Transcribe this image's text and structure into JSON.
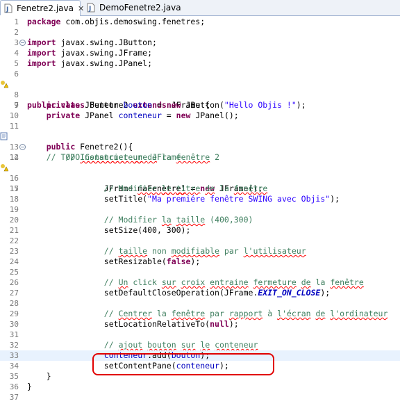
{
  "tabs": [
    {
      "label": "Fenetre2.java",
      "icon": "java-file-icon",
      "active": true,
      "close": "✕"
    },
    {
      "label": "DemoFenetre2.java",
      "icon": "java-file-icon",
      "active": false
    }
  ],
  "line_numbers": [
    "1",
    "2",
    "3",
    "4",
    "5",
    "6",
    "7",
    "8",
    "9",
    "10",
    "11",
    "12",
    "13",
    "14",
    "15",
    "16",
    "17",
    "18",
    "19",
    "20",
    "21",
    "22",
    "23",
    "24",
    "25",
    "26",
    "27",
    "28",
    "29",
    "30",
    "31",
    "32",
    "33",
    "34",
    "35",
    "36",
    "37"
  ],
  "fold_glyph": "−",
  "code": {
    "l1": {
      "kw": "package",
      "rest": " com.objis.demoswing.fenetres;"
    },
    "l3": {
      "kw": "import",
      "rest": " javax.swing.JButton;"
    },
    "l4": {
      "kw": "import",
      "rest": " javax.swing.JFrame;"
    },
    "l5": {
      "kw": "import",
      "rest": " javax.swing.JPanel;"
    },
    "l7": {
      "kw1": "public",
      "kw2": "class",
      "name": "Fenetre2",
      "kw3": "extends",
      "rest": " JFrame {"
    },
    "l9": {
      "kw1": "private",
      "t1": " JButton ",
      "field": "bouton",
      "t2": " = ",
      "kw2": "new",
      "t3": " JButton(",
      "str": "\"Hello Objis !\"",
      "t4": ");"
    },
    "l10": {
      "kw1": "private",
      "t1": " JPanel ",
      "field": "conteneur",
      "t2": " = ",
      "kw2": "new",
      "t3": " JPanel();"
    },
    "l12": {
      "c1": "// TODO ",
      "c2": "Constructeur",
      "c3": " ",
      "c4": "de",
      "c5": " la ",
      "c6": "fenêtre",
      "c7": " 2"
    },
    "l13": {
      "kw": "public",
      "rest": " Fenetre2(){"
    },
    "l14": {
      "c1": "// ",
      "c2": "Instancier",
      "c3": " ",
      "c4": "une",
      "c5": " JFrame"
    },
    "l15": {
      "t1": "JFrame ",
      "var": "maFenetre1",
      "t2": " = ",
      "kw": "new",
      "t3": " JFrame();"
    },
    "l17": {
      "c1": "// Modifier ",
      "c2": "le",
      "c3": " ",
      "c4": "titre",
      "c5": " ",
      "c6": "de",
      "c7": " la ",
      "c8": "fenêtre"
    },
    "l18": {
      "t1": "setTitle(",
      "str": "\"Ma premiére fenêtre SWING avec Objis\"",
      "t2": ");"
    },
    "l20": {
      "c1": "// Modifier ",
      "c2": "la",
      "c3": " ",
      "c4": "taille",
      "c5": " (400,300)"
    },
    "l21": {
      "t1": "setSize(400, 300);"
    },
    "l23": {
      "c1": "// ",
      "c2": "taille",
      "c3": " non ",
      "c4": "modifiable",
      "c5": " par ",
      "c6": "l'utilisateur"
    },
    "l24": {
      "t1": "setResizable(",
      "kw": "false",
      "t2": ");"
    },
    "l26": {
      "c1": "// ",
      "c2": "Un",
      "c3": " click ",
      "c4": "sur",
      "c5": " ",
      "c6": "croix",
      "c7": " ",
      "c8": "entraine",
      "c9": " ",
      "c10": "fermeture",
      "c11": " ",
      "c12": "de",
      "c13": " la ",
      "c14": "fenêtre"
    },
    "l27": {
      "t1": "setDefaultCloseOperation(JFrame.",
      "sf": "EXIT_ON_CLOSE",
      "t2": ");"
    },
    "l29": {
      "c1": "// ",
      "c2": "Centrer",
      "c3": " la ",
      "c4": "fenêtre",
      "c5": " par ",
      "c6": "rapport",
      "c7": " à ",
      "c8": "l'écran",
      "c9": " ",
      "c10": "de",
      "c11": " ",
      "c12": "l'ordinateur"
    },
    "l30": {
      "t1": "setLocationRelativeTo(",
      "kw": "null",
      "t2": ");"
    },
    "l32": {
      "c1": "// ",
      "c2": "ajout",
      "c3": " ",
      "c4": "bouton",
      "c5": " ",
      "c6": "sur",
      "c7": " ",
      "c8": "le",
      "c9": " ",
      "c10": "conteneur"
    },
    "l33": {
      "field": "conteneur",
      "t1": ".add(",
      "field2": "bouton",
      "t2": ");"
    },
    "l34": {
      "t1": "setContentPane(",
      "field": "conteneur",
      "t2": ");"
    },
    "l35": {
      "t1": "}"
    },
    "l36": {
      "t1": "}"
    }
  },
  "colors": {
    "keyword": "#7f0055",
    "comment": "#3f7f5f",
    "string": "#2a00ff",
    "field": "#0000c0",
    "current_line": "#e8f2fe",
    "callout": "#e10000"
  }
}
